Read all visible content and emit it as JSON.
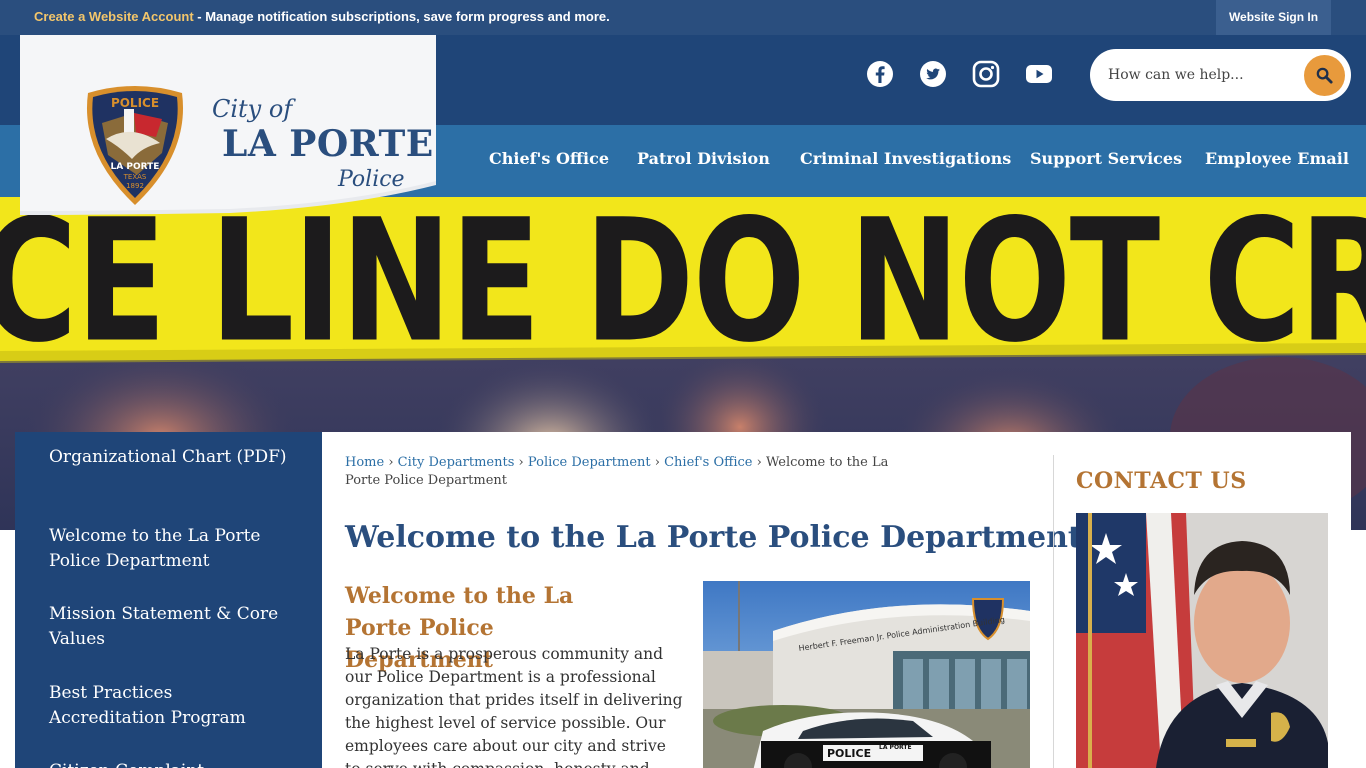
{
  "topbar": {
    "create_account": "Create a Website Account",
    "create_account_desc": " - Manage notification subscriptions, save form progress and more.",
    "sign_in": "Website Sign In"
  },
  "logo": {
    "city_of": "City of",
    "name": "LA PORTE",
    "police": "Police",
    "badge_top": "POLICE",
    "badge_city": "LA PORTE",
    "badge_state": "TEXAS",
    "badge_year": "1892"
  },
  "social": [
    "facebook-icon",
    "twitter-icon",
    "instagram-icon",
    "youtube-icon"
  ],
  "search": {
    "placeholder": "How can we help..."
  },
  "nav": {
    "items": [
      "Chief's Office",
      "Patrol Division",
      "Criminal Investigations",
      "Support Services",
      "Employee Email"
    ]
  },
  "hero": {
    "tape_text": "CE LINE DO NOT CR"
  },
  "sidebar": {
    "items": [
      "Organizational Chart (PDF)",
      "Welcome to the La Porte Police Department",
      "Mission Statement & Core Values",
      "Best Practices Accreditation Program",
      "Citizen Complaint"
    ]
  },
  "breadcrumb": {
    "links": [
      "Home",
      "City Departments",
      "Police Department",
      "Chief's Office"
    ],
    "separator": "›",
    "current": "Welcome to the La Porte Police Department"
  },
  "main": {
    "title": "Welcome to the La Porte Police Department",
    "subtitle": "Welcome to the La Porte Police Department",
    "body": "La Porte is a prosperous community and our Police Department is a professional organization that prides itself in delivering the highest level of service possible. Our employees care about our city and strive to serve with compassion, honesty and",
    "building_sign": "Herbert F. Freeman Jr. Police Administration Building",
    "car_text": "POLICE",
    "car_city": "LA PORTE"
  },
  "contact": {
    "title": "CONTACT US"
  },
  "colors": {
    "header_navy": "#1f4578",
    "nav_blue": "#2c6fa6",
    "accent_orange": "#e89a3c",
    "heading_brown": "#b47433",
    "title_blue": "#2a4e7e",
    "tape_yellow": "#f2e61b"
  }
}
